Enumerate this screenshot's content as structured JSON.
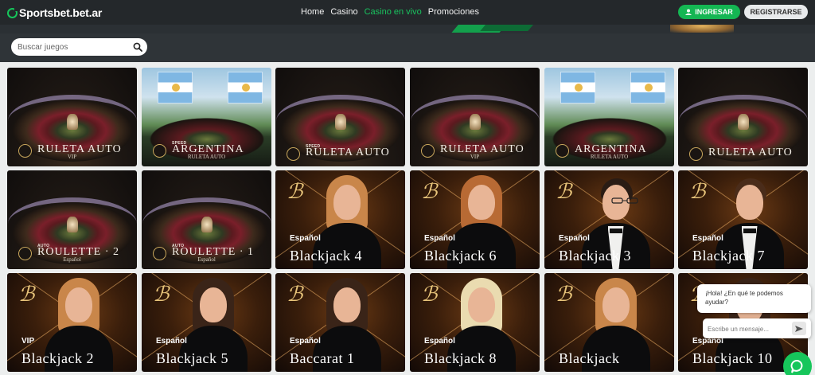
{
  "header": {
    "logo": "Sportsbet.bet.ar",
    "nav": [
      {
        "label": "Home",
        "active": false
      },
      {
        "label": "Casino",
        "active": false
      },
      {
        "label": "Casino en vivo",
        "active": true
      },
      {
        "label": "Promociones",
        "active": false
      }
    ],
    "login_label": "INGRESAR",
    "register_label": "REGISTRARSE"
  },
  "search": {
    "placeholder": "Buscar juegos",
    "value": ""
  },
  "games": [
    {
      "type": "roulette",
      "top": "",
      "title": "RULETA AUTO",
      "sub": "VIP"
    },
    {
      "type": "argentina",
      "top": "SPEED",
      "title": "ARGENTINA",
      "sub": "RULETA AUTO"
    },
    {
      "type": "roulette",
      "top": "SPEED",
      "title": "RULETA AUTO",
      "sub": ""
    },
    {
      "type": "roulette",
      "top": "",
      "title": "RULETA AUTO",
      "sub": "VIP"
    },
    {
      "type": "argentina",
      "top": "",
      "title": "ARGENTINA",
      "sub": "RULETA AUTO"
    },
    {
      "type": "roulette",
      "top": "",
      "title": "RULETA AUTO",
      "sub": ""
    },
    {
      "type": "roulette",
      "top": "AUTO",
      "title": "ROULETTE · 2",
      "sub": "Español"
    },
    {
      "type": "roulette",
      "top": "AUTO",
      "title": "ROULETTE · 1",
      "sub": "Español"
    },
    {
      "type": "dealer",
      "lang": "Español",
      "name": "Blackjack 4",
      "dealer": "woman-blonde"
    },
    {
      "type": "dealer",
      "lang": "Español",
      "name": "Blackjack 6",
      "dealer": "woman-red"
    },
    {
      "type": "dealer",
      "lang": "Español",
      "name": "Blackjack 3",
      "dealer": "man-glasses"
    },
    {
      "type": "dealer",
      "lang": "Español",
      "name": "Blackjack 7",
      "dealer": "man"
    },
    {
      "type": "dealer",
      "lang": "VIP",
      "name": "Blackjack 2",
      "dealer": "woman-blonde"
    },
    {
      "type": "dealer",
      "lang": "Español",
      "name": "Blackjack 5",
      "dealer": "woman-dark"
    },
    {
      "type": "dealer",
      "lang": "Español",
      "name": "Baccarat 1",
      "dealer": "woman-dark"
    },
    {
      "type": "dealer",
      "lang": "Español",
      "name": "Blackjack 8",
      "dealer": "woman-platinum"
    },
    {
      "type": "dealer",
      "lang": "",
      "name": "Blackjack",
      "dealer": "woman-blonde"
    },
    {
      "type": "dealer",
      "lang": "Español",
      "name": "Blackjack 10",
      "dealer": "woman-dark"
    }
  ],
  "chat": {
    "greeting": "¡Hola! ¿En qué te podemos ayudar?",
    "input_placeholder": "Escribe un mensaje..."
  },
  "colors": {
    "accent": "#16c65b",
    "header_bg": "#24282b",
    "grid_bg": "#eceeee"
  }
}
